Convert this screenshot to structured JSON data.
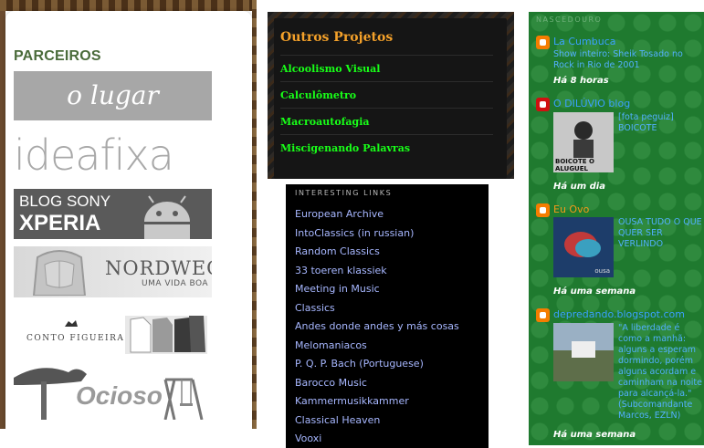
{
  "parceiros": {
    "title": "PARCEIROS",
    "partners": [
      {
        "name": "o lugar"
      },
      {
        "name": "ideafixa"
      },
      {
        "line1": "BLOG SONY",
        "line2": "XPERIA"
      },
      {
        "line1": "NORDWEG",
        "line2": "UMA VIDA BOA"
      },
      {
        "line1": "CONTO FIGUEIRA"
      },
      {
        "line1": "Ocioso"
      }
    ]
  },
  "projetos": {
    "title": "Outros Projetos",
    "items": [
      "Alcoolismo Visual",
      "Calculômetro",
      "Macroautofagia",
      "Miscigenando Palavras"
    ]
  },
  "links": {
    "title": "INTERESTING LINKS",
    "items": [
      "European Archive",
      "IntoClassics (in russian)",
      "Random Classics",
      "33 toeren klassiek",
      "Meeting in Music",
      "Classics",
      "Andes donde andes y más cosas",
      "Melomaniacos",
      "P. Q. P. Bach (Portuguese)",
      "Barocco Music",
      "Kammermusikkammer",
      "Classical Heaven",
      "Vooxi"
    ]
  },
  "bloglist": {
    "title": "NASCEDOURO",
    "entries": [
      {
        "name": "La Cumbuca",
        "snippet": "Show inteiro: Sheik Tosado no Rock in Rio de 2001",
        "time": "Há 8 horas"
      },
      {
        "name": "O DILÚVIO blog",
        "snippet": "[fota peguiz] BOICOTE",
        "thumb_text": "BOICOTE O ALUGUEL",
        "time": "Há um dia"
      },
      {
        "name": "Eu Ovo",
        "snippet": "OUSA TUDO O QUE QUER SER VERLINDO",
        "thumb_text": "ousa",
        "time": "Há uma semana"
      },
      {
        "name": "depredando.blogspot.com",
        "snippet": "\"A liberdade é como a manhã: alguns a esperam dormindo, porém alguns acordam e caminham na noite para alcançá-la.\" (Subcomandante Marcos, EZLN)",
        "time": "Há uma semana"
      }
    ]
  },
  "colors": {
    "parceiros_title": "#4a6b3a",
    "projetos_title": "#f4a12a",
    "projetos_item": "#18ff18",
    "link": "#a7b7ff",
    "blog_name": "#3aa0ff",
    "blog_name_alt": "#f59a1a",
    "blog_snippet": "#52b0ff",
    "blog_bg": "#1f7a2f"
  }
}
